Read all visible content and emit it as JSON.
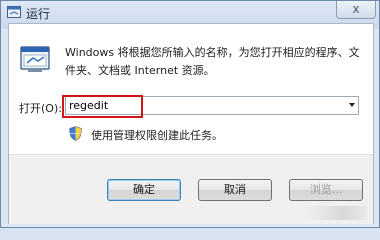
{
  "window": {
    "title": "运行",
    "close_symbol": "x"
  },
  "description": "Windows 将根据您所输入的名称，为您打开相应的程序、文件夹、文档或 Internet 资源。",
  "open_field": {
    "label": "打开(O):",
    "value": "regedit"
  },
  "admin_note": "使用管理权限创建此任务。",
  "buttons": {
    "ok": "确定",
    "cancel": "取消",
    "browse": "浏览..."
  },
  "colors": {
    "highlight_border": "#d01616",
    "title_bar": "#c9d9ec",
    "button_area": "#f0f0f0"
  },
  "icons": [
    "run-app-icon",
    "run-dialog-icon",
    "uac-shield-icon",
    "close-icon",
    "chevron-down-icon"
  ]
}
